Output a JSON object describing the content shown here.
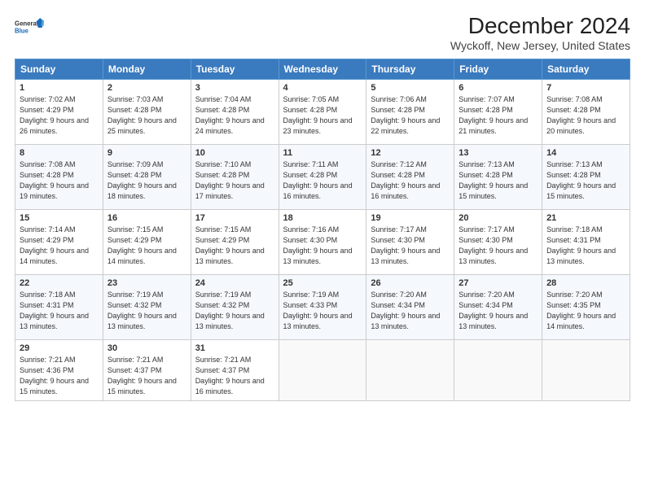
{
  "header": {
    "logo_line1": "General",
    "logo_line2": "Blue",
    "title": "December 2024",
    "subtitle": "Wyckoff, New Jersey, United States"
  },
  "columns": [
    "Sunday",
    "Monday",
    "Tuesday",
    "Wednesday",
    "Thursday",
    "Friday",
    "Saturday"
  ],
  "weeks": [
    [
      {
        "day": "1",
        "rise": "Sunrise: 7:02 AM",
        "set": "Sunset: 4:29 PM",
        "daylight": "Daylight: 9 hours and 26 minutes."
      },
      {
        "day": "2",
        "rise": "Sunrise: 7:03 AM",
        "set": "Sunset: 4:28 PM",
        "daylight": "Daylight: 9 hours and 25 minutes."
      },
      {
        "day": "3",
        "rise": "Sunrise: 7:04 AM",
        "set": "Sunset: 4:28 PM",
        "daylight": "Daylight: 9 hours and 24 minutes."
      },
      {
        "day": "4",
        "rise": "Sunrise: 7:05 AM",
        "set": "Sunset: 4:28 PM",
        "daylight": "Daylight: 9 hours and 23 minutes."
      },
      {
        "day": "5",
        "rise": "Sunrise: 7:06 AM",
        "set": "Sunset: 4:28 PM",
        "daylight": "Daylight: 9 hours and 22 minutes."
      },
      {
        "day": "6",
        "rise": "Sunrise: 7:07 AM",
        "set": "Sunset: 4:28 PM",
        "daylight": "Daylight: 9 hours and 21 minutes."
      },
      {
        "day": "7",
        "rise": "Sunrise: 7:08 AM",
        "set": "Sunset: 4:28 PM",
        "daylight": "Daylight: 9 hours and 20 minutes."
      }
    ],
    [
      {
        "day": "8",
        "rise": "Sunrise: 7:08 AM",
        "set": "Sunset: 4:28 PM",
        "daylight": "Daylight: 9 hours and 19 minutes."
      },
      {
        "day": "9",
        "rise": "Sunrise: 7:09 AM",
        "set": "Sunset: 4:28 PM",
        "daylight": "Daylight: 9 hours and 18 minutes."
      },
      {
        "day": "10",
        "rise": "Sunrise: 7:10 AM",
        "set": "Sunset: 4:28 PM",
        "daylight": "Daylight: 9 hours and 17 minutes."
      },
      {
        "day": "11",
        "rise": "Sunrise: 7:11 AM",
        "set": "Sunset: 4:28 PM",
        "daylight": "Daylight: 9 hours and 16 minutes."
      },
      {
        "day": "12",
        "rise": "Sunrise: 7:12 AM",
        "set": "Sunset: 4:28 PM",
        "daylight": "Daylight: 9 hours and 16 minutes."
      },
      {
        "day": "13",
        "rise": "Sunrise: 7:13 AM",
        "set": "Sunset: 4:28 PM",
        "daylight": "Daylight: 9 hours and 15 minutes."
      },
      {
        "day": "14",
        "rise": "Sunrise: 7:13 AM",
        "set": "Sunset: 4:28 PM",
        "daylight": "Daylight: 9 hours and 15 minutes."
      }
    ],
    [
      {
        "day": "15",
        "rise": "Sunrise: 7:14 AM",
        "set": "Sunset: 4:29 PM",
        "daylight": "Daylight: 9 hours and 14 minutes."
      },
      {
        "day": "16",
        "rise": "Sunrise: 7:15 AM",
        "set": "Sunset: 4:29 PM",
        "daylight": "Daylight: 9 hours and 14 minutes."
      },
      {
        "day": "17",
        "rise": "Sunrise: 7:15 AM",
        "set": "Sunset: 4:29 PM",
        "daylight": "Daylight: 9 hours and 13 minutes."
      },
      {
        "day": "18",
        "rise": "Sunrise: 7:16 AM",
        "set": "Sunset: 4:30 PM",
        "daylight": "Daylight: 9 hours and 13 minutes."
      },
      {
        "day": "19",
        "rise": "Sunrise: 7:17 AM",
        "set": "Sunset: 4:30 PM",
        "daylight": "Daylight: 9 hours and 13 minutes."
      },
      {
        "day": "20",
        "rise": "Sunrise: 7:17 AM",
        "set": "Sunset: 4:30 PM",
        "daylight": "Daylight: 9 hours and 13 minutes."
      },
      {
        "day": "21",
        "rise": "Sunrise: 7:18 AM",
        "set": "Sunset: 4:31 PM",
        "daylight": "Daylight: 9 hours and 13 minutes."
      }
    ],
    [
      {
        "day": "22",
        "rise": "Sunrise: 7:18 AM",
        "set": "Sunset: 4:31 PM",
        "daylight": "Daylight: 9 hours and 13 minutes."
      },
      {
        "day": "23",
        "rise": "Sunrise: 7:19 AM",
        "set": "Sunset: 4:32 PM",
        "daylight": "Daylight: 9 hours and 13 minutes."
      },
      {
        "day": "24",
        "rise": "Sunrise: 7:19 AM",
        "set": "Sunset: 4:32 PM",
        "daylight": "Daylight: 9 hours and 13 minutes."
      },
      {
        "day": "25",
        "rise": "Sunrise: 7:19 AM",
        "set": "Sunset: 4:33 PM",
        "daylight": "Daylight: 9 hours and 13 minutes."
      },
      {
        "day": "26",
        "rise": "Sunrise: 7:20 AM",
        "set": "Sunset: 4:34 PM",
        "daylight": "Daylight: 9 hours and 13 minutes."
      },
      {
        "day": "27",
        "rise": "Sunrise: 7:20 AM",
        "set": "Sunset: 4:34 PM",
        "daylight": "Daylight: 9 hours and 13 minutes."
      },
      {
        "day": "28",
        "rise": "Sunrise: 7:20 AM",
        "set": "Sunset: 4:35 PM",
        "daylight": "Daylight: 9 hours and 14 minutes."
      }
    ],
    [
      {
        "day": "29",
        "rise": "Sunrise: 7:21 AM",
        "set": "Sunset: 4:36 PM",
        "daylight": "Daylight: 9 hours and 15 minutes."
      },
      {
        "day": "30",
        "rise": "Sunrise: 7:21 AM",
        "set": "Sunset: 4:37 PM",
        "daylight": "Daylight: 9 hours and 15 minutes."
      },
      {
        "day": "31",
        "rise": "Sunrise: 7:21 AM",
        "set": "Sunset: 4:37 PM",
        "daylight": "Daylight: 9 hours and 16 minutes."
      },
      null,
      null,
      null,
      null
    ]
  ]
}
